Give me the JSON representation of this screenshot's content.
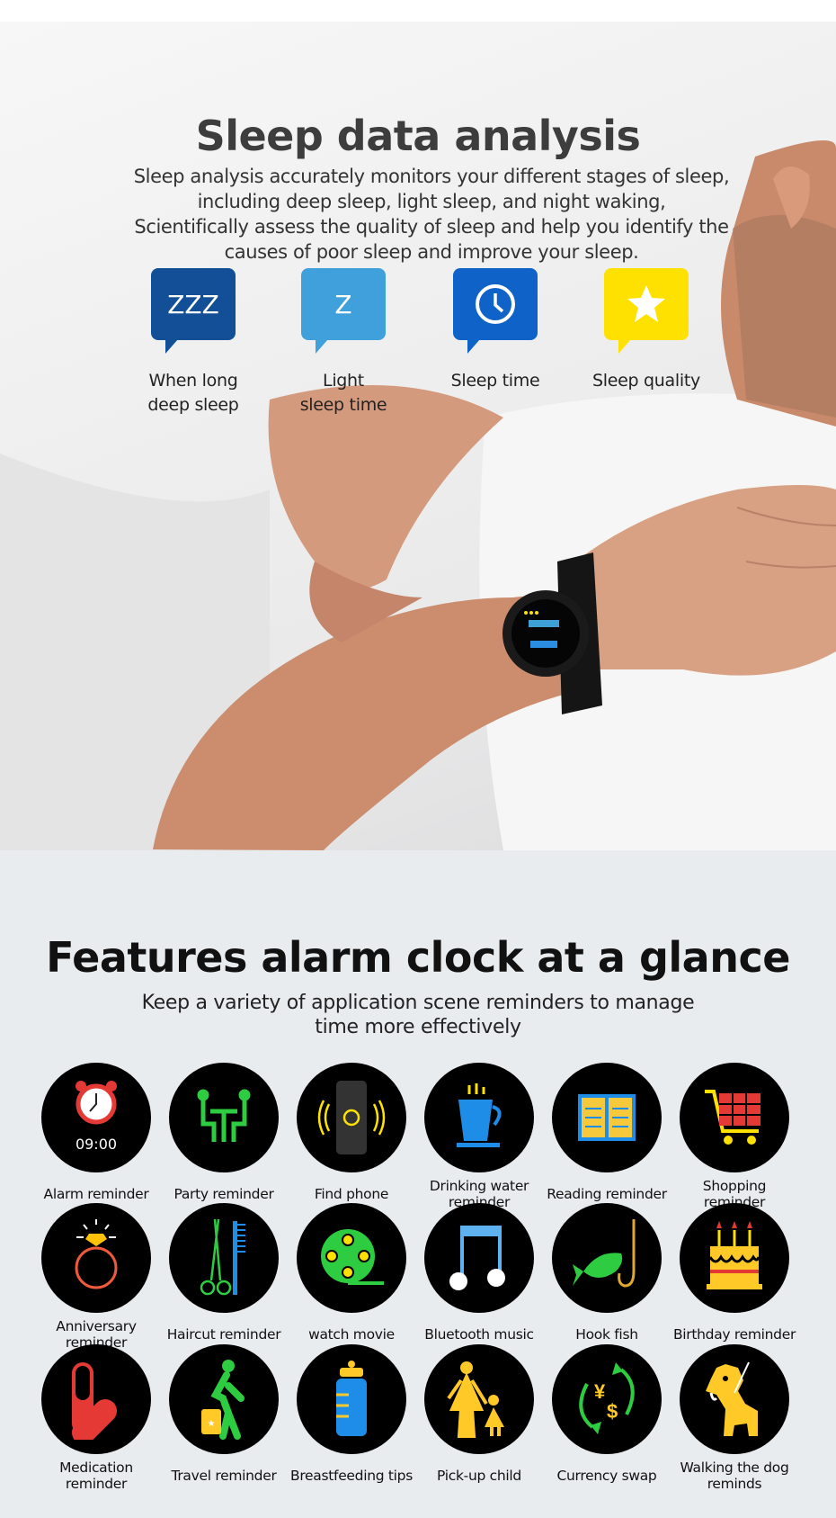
{
  "sleep": {
    "title": "Sleep data analysis",
    "description_lines": [
      "Sleep analysis accurately monitors your different stages of sleep,",
      "including deep sleep, light sleep, and night waking,",
      "Scientifically assess the quality of sleep and help you identify the",
      "causes of poor sleep and improve your sleep."
    ],
    "items": [
      {
        "icon": "zzz-icon",
        "glyph": "ZZZ",
        "color": "#134f97",
        "label_lines": [
          "When long",
          "deep sleep"
        ]
      },
      {
        "icon": "z-icon",
        "glyph": "Z",
        "color": "#40a0db",
        "label_lines": [
          "Light",
          "sleep time"
        ]
      },
      {
        "icon": "clock-icon",
        "glyph": "",
        "color": "#0f63c8",
        "label_lines": [
          "Sleep time",
          ""
        ]
      },
      {
        "icon": "star-icon",
        "glyph": "",
        "color": "#ffe100",
        "label_lines": [
          "Sleep quality",
          ""
        ]
      }
    ]
  },
  "features": {
    "title": "Features alarm clock at a glance",
    "subtitle_lines": [
      "Keep a variety of application scene reminders to manage",
      "time more effectively"
    ],
    "alarm_time": "09:00",
    "items": [
      {
        "icon": "alarm-clock-icon",
        "label": "Alarm reminder"
      },
      {
        "icon": "party-table-icon",
        "label": "Party reminder"
      },
      {
        "icon": "phone-vibrate-icon",
        "label": "Find phone"
      },
      {
        "icon": "coffee-cup-icon",
        "label": "Drinking water reminder"
      },
      {
        "icon": "open-book-icon",
        "label": "Reading reminder"
      },
      {
        "icon": "shopping-cart-icon",
        "label": "Shopping reminder"
      },
      {
        "icon": "diamond-ring-icon",
        "label": "Anniversary reminder"
      },
      {
        "icon": "scissors-comb-icon",
        "label": "Haircut reminder"
      },
      {
        "icon": "film-reel-icon",
        "label": "watch movie"
      },
      {
        "icon": "music-note-icon",
        "label": "Bluetooth music"
      },
      {
        "icon": "fish-hook-icon",
        "label": "Hook fish"
      },
      {
        "icon": "birthday-cake-icon",
        "label": "Birthday reminder"
      },
      {
        "icon": "pill-icon",
        "label": "Medication reminder"
      },
      {
        "icon": "traveler-suitcase-icon",
        "label": "Travel reminder"
      },
      {
        "icon": "baby-bottle-icon",
        "label": "Breastfeeding tips"
      },
      {
        "icon": "parent-child-icon",
        "label": "Pick-up child"
      },
      {
        "icon": "currency-exchange-icon",
        "label": "Currency swap"
      },
      {
        "icon": "dog-icon",
        "label": "Walking the dog reminds"
      }
    ]
  }
}
